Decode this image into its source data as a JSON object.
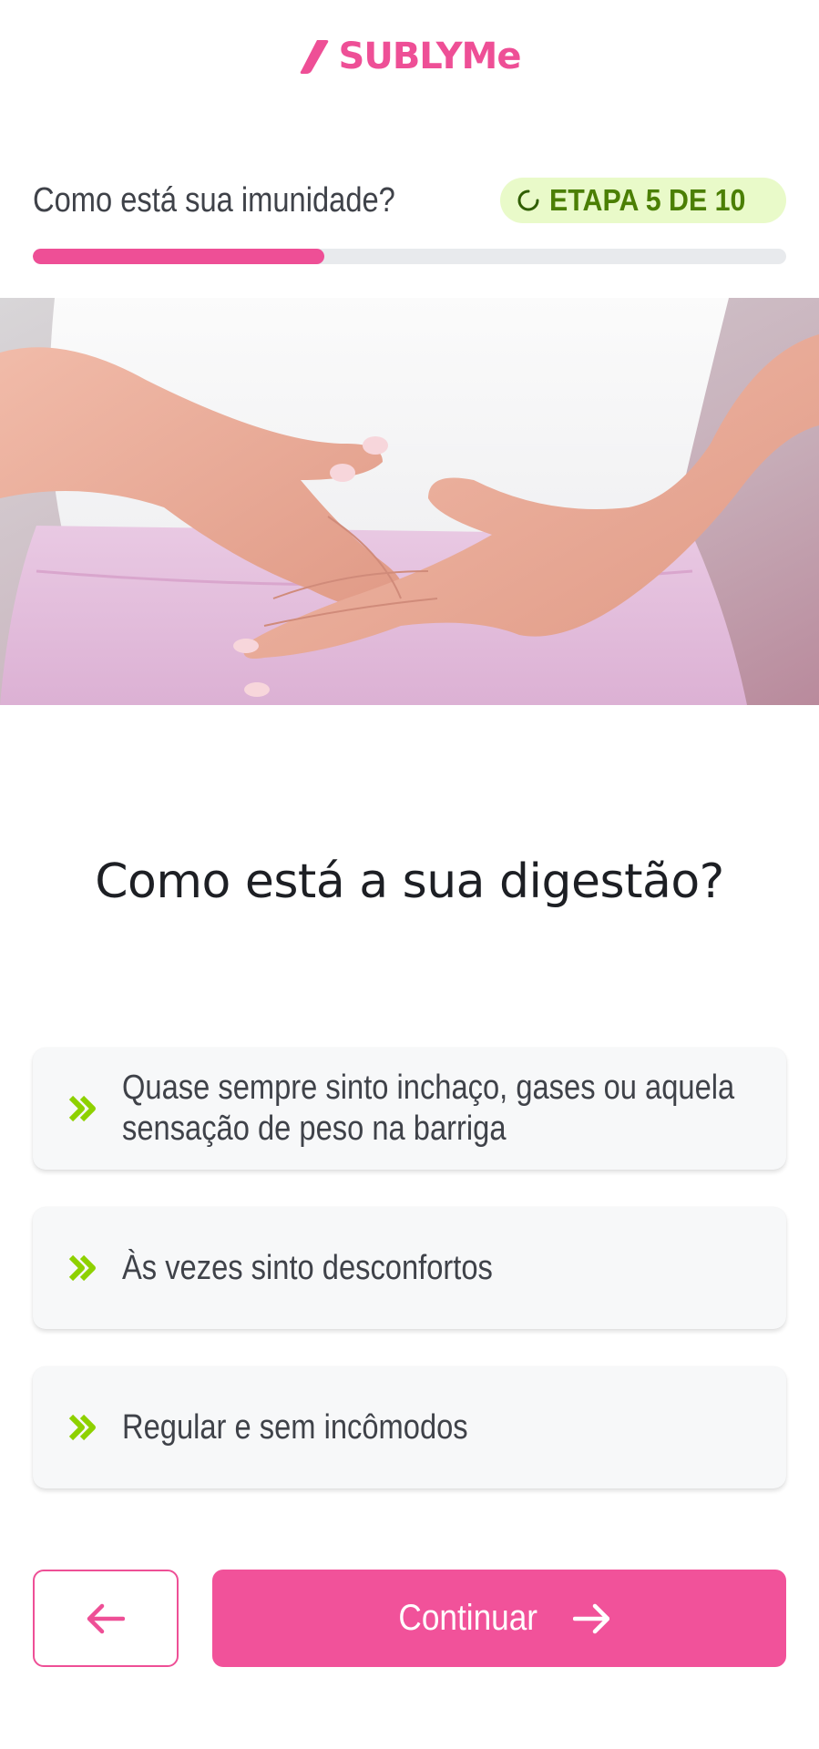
{
  "brand": {
    "name": "SUBLYMe",
    "color": "#ee4f96"
  },
  "progress": {
    "section_title": "Como está sua imunidade?",
    "step_label": "ETAPA 5 DE 10",
    "fraction": 0.387
  },
  "hero": {
    "icon": "hands-on-belly-photo"
  },
  "question": "Como está a sua digestão?",
  "options": [
    {
      "label": " Quase sempre sinto inchaço, gases ou aquela sensação de peso na barriga",
      "icon": "chevron-right-double-icon"
    },
    {
      "label": "Às vezes sinto desconfortos",
      "icon": "chevron-right-double-icon"
    },
    {
      "label": "Regular e sem incômodos",
      "icon": "chevron-right-double-icon"
    }
  ],
  "footer": {
    "back_icon": "arrow-left-icon",
    "continue_label": "Continuar",
    "continue_icon": "arrow-right-icon"
  },
  "colors": {
    "accent": "#ee4f96",
    "badge_bg": "#e9fac9",
    "badge_text": "#4b7f04",
    "chevron": "#8ed100"
  }
}
